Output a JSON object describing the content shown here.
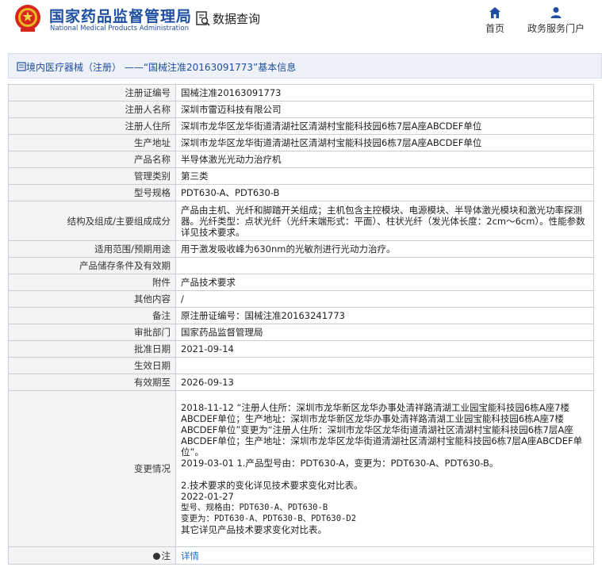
{
  "header": {
    "brand_cn": "国家药品监督管理局",
    "brand_en": "National Medical Products Administration",
    "section_title": "数据查询",
    "nav_home": "首页",
    "nav_gov": "政务服务门户"
  },
  "breadcrumb": {
    "text": "境内医疗器械（注册） ——“国械注准20163091773”基本信息"
  },
  "details": [
    {
      "label": "注册证编号",
      "value": "国械注准20163091773"
    },
    {
      "label": "注册人名称",
      "value": "深圳市雷迈科技有限公司"
    },
    {
      "label": "注册人住所",
      "value": "深圳市龙华区龙华街道清湖社区清湖村宝能科技园6栋7层A座ABCDEF单位"
    },
    {
      "label": "生产地址",
      "value": "深圳市龙华区龙华街道清湖社区清湖村宝能科技园6栋7层A座ABCDEF单位"
    },
    {
      "label": "产品名称",
      "value": "半导体激光光动力治疗机"
    },
    {
      "label": "管理类别",
      "value": "第三类"
    },
    {
      "label": "型号规格",
      "value": "PDT630-A、PDT630-B"
    },
    {
      "label": "结构及组成/主要组成成分",
      "value": "产品由主机、光纤和脚踏开关组成；主机包含主控模块、电源模块、半导体激光模块和激光功率探测器。光纤类型：点状光纤（光纤末端形式：平面）、柱状光纤（发光体长度：2cm～6cm）。性能参数详见技术要求。"
    },
    {
      "label": "适用范围/预期用途",
      "value": "用于激发吸收峰为630nm的光敏剂进行光动力治疗。"
    },
    {
      "label": "产品储存条件及有效期",
      "value": ""
    },
    {
      "label": "附件",
      "value": "产品技术要求"
    },
    {
      "label": "其他内容",
      "value": "/"
    },
    {
      "label": "备注",
      "value": "原注册证编号：国械注准20163241773"
    },
    {
      "label": "审批部门",
      "value": "国家药品监督管理局"
    },
    {
      "label": "批准日期",
      "value": "2021-09-14"
    },
    {
      "label": "生效日期",
      "value": ""
    },
    {
      "label": "有效期至",
      "value": "2026-09-13"
    }
  ],
  "change_history": {
    "label": "变更情况",
    "entry1": "2018-11-12 “注册人住所：深圳市龙华新区龙华办事处清祥路清湖工业园宝能科技园6栋A座7楼ABCDEF单位；生产地址：深圳市龙华新区龙华办事处清祥路清湖工业园宝能科技园6栋A座7楼ABCDEF单位”变更为“注册人住所：深圳市龙华区龙华街道清湖社区清湖村宝能科技园6栋7层A座ABCDEF单位；生产地址：深圳市龙华区龙华街道清湖社区清湖村宝能科技园6栋7层A座ABCDEF单位”。",
    "entry2_line1": "2019-03-01 1.产品型号由：PDT630-A，变更为：PDT630-A、PDT630-B。",
    "entry2_line2": "2.技术要求的变化详见技术要求变化对比表。",
    "entry3_date": "2022-01-27",
    "entry3_line1": "型号、规格由：PDT630-A、PDT630-B",
    "entry3_line2": "变更为：PDT630-A、PDT630-B、PDT630-D2",
    "entry3_line3": "其它详见产品技术要求变化对比表。"
  },
  "note_row": {
    "label": "注",
    "link": "详情"
  },
  "colors": {
    "brand_blue": "#1f4fa3",
    "link_blue": "#1f6fd1",
    "label_bg": "#f4f4f4",
    "border": "#c9ced6"
  }
}
